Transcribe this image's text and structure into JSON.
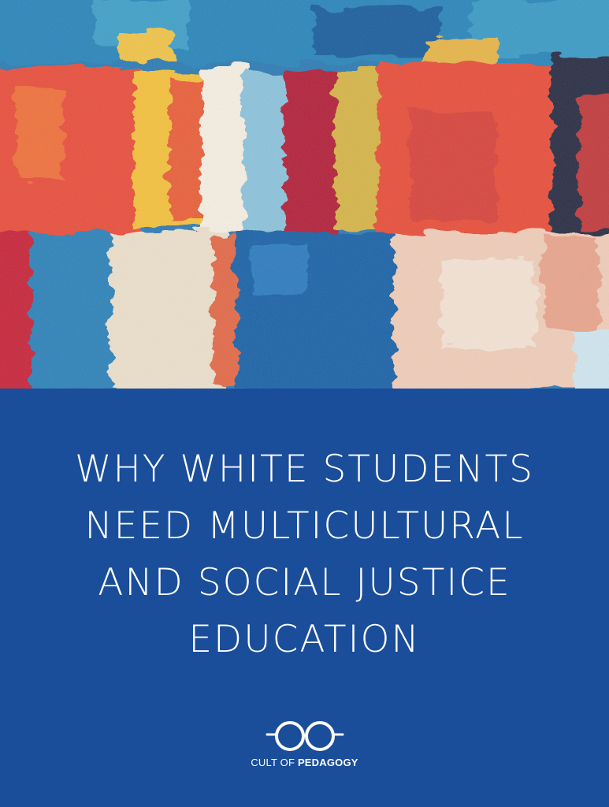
{
  "cover": {
    "image_alt": "abstract painting",
    "title_lines": [
      "WHY WHITE STUDENTS",
      "NEED MULTICULTURAL",
      "AND SOCIAL JUSTICE",
      "EDUCATION"
    ],
    "background_color": "#1a4d9a",
    "text_color": "#ffffff"
  },
  "logo": {
    "icon": "glasses-icon",
    "brand_light": "CULT OF ",
    "brand_bold": "PEDAGOGY"
  },
  "palette": {
    "blue": "#1f6fae",
    "red": "#e8503a",
    "yellow": "#f4c13c",
    "crimson": "#b3223a",
    "cream": "#efe3cf"
  }
}
